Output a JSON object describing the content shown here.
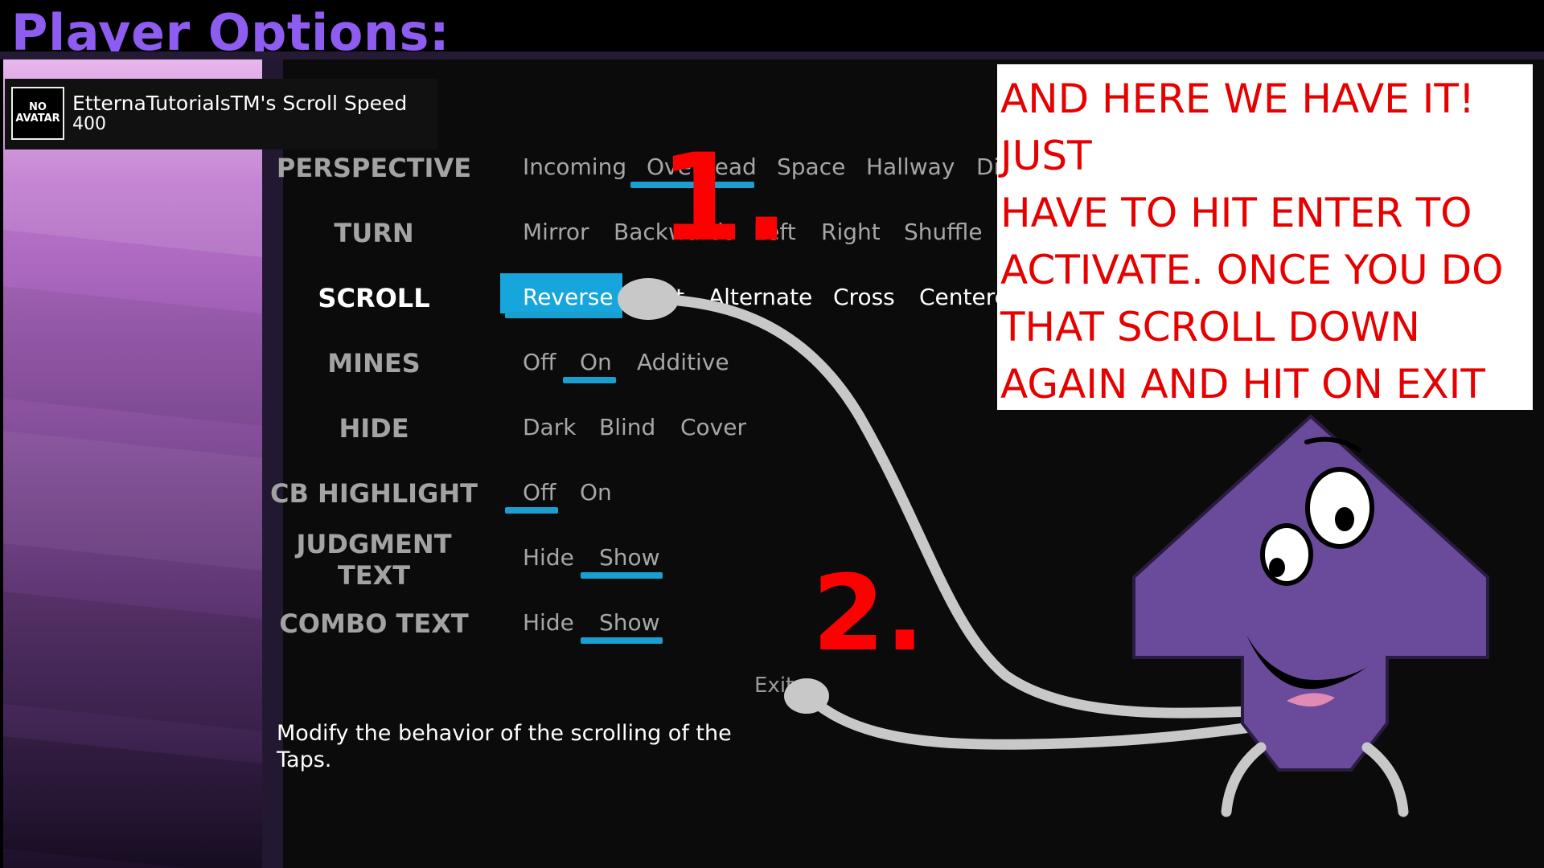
{
  "screen": {
    "title": "Player Options:"
  },
  "profile": {
    "avatar_text": "NO AVATAR",
    "name": "EtternaTutorialsTM's Scroll Speed",
    "speed": "400"
  },
  "options": {
    "perspective": {
      "label": "PERSPECTIVE",
      "choices": [
        "Incoming",
        "Overhead",
        "Space",
        "Hallway",
        "Di"
      ],
      "selected": "Overhead"
    },
    "turn": {
      "label": "TURN",
      "choices": [
        "Mirror",
        "Backwards",
        "Left",
        "Right",
        "Shuffle"
      ]
    },
    "scroll": {
      "label": "SCROLL",
      "choices": [
        "Reverse",
        "Split",
        "Alternate",
        "Cross",
        "Centere"
      ],
      "selected": "Reverse",
      "cursor": "Reverse"
    },
    "mines": {
      "label": "MINES",
      "choices": [
        "Off",
        "On",
        "Additive"
      ],
      "selected": "On"
    },
    "hide": {
      "label": "HIDE",
      "choices": [
        "Dark",
        "Blind",
        "Cover"
      ]
    },
    "cb_highlight": {
      "label": "CB HIGHLIGHT",
      "choices": [
        "Off",
        "On"
      ],
      "selected": "Off"
    },
    "judgment_text": {
      "label_line1": "JUDGMENT",
      "label_line2": "TEXT",
      "choices": [
        "Hide",
        "Show"
      ],
      "selected": "Show"
    },
    "combo_text": {
      "label": "COMBO TEXT",
      "choices": [
        "Hide",
        "Show"
      ],
      "selected": "Show"
    },
    "exit_label": "Exit"
  },
  "explanation": "Modify the behavior of the scrolling of the Taps.",
  "annotation": {
    "note_lines": [
      "AND HERE WE HAVE IT!",
      "JUST",
      "HAVE TO HIT ENTER TO",
      "ACTIVATE. ONCE YOU DO",
      "THAT SCROLL DOWN",
      "AGAIN AND HIT ON EXIT"
    ],
    "step_1": "1.",
    "step_2": "2."
  },
  "colors": {
    "title": "#8e5cf0",
    "accent_underline": "#1a9fd1",
    "cursor": "#16a6db",
    "annotation_text": "#e60000",
    "mascot": "#6a4a9a"
  },
  "icons": {
    "mascot": "purple-arrow-mascot-icon"
  }
}
